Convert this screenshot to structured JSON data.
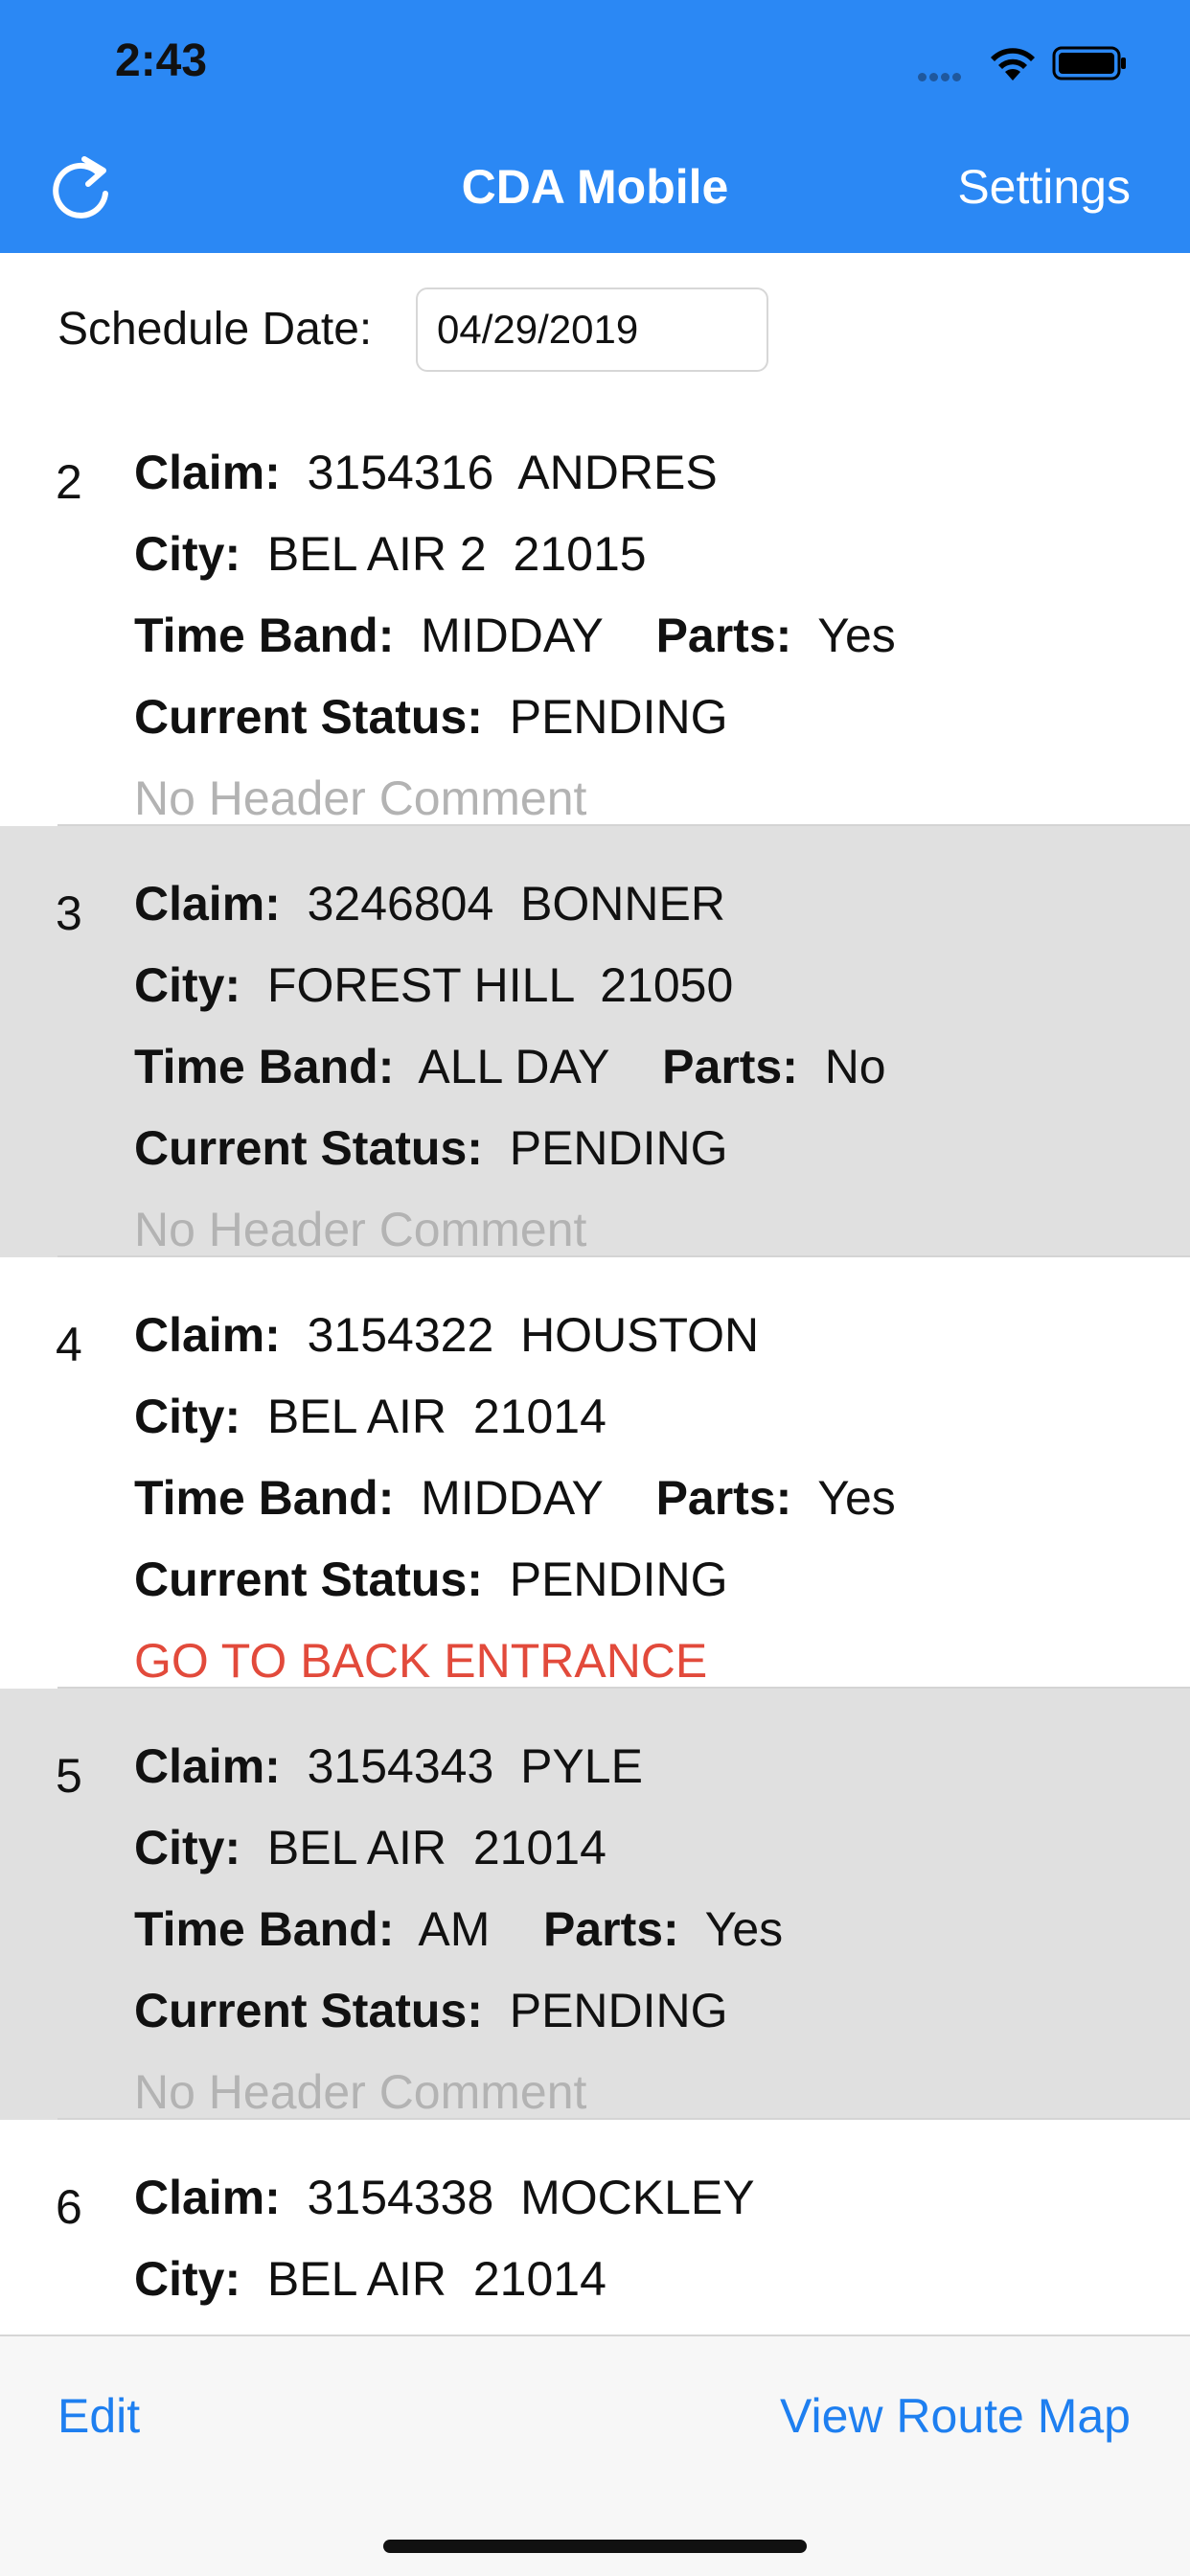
{
  "status_bar": {
    "time": "2:43"
  },
  "nav": {
    "title": "CDA Mobile",
    "settings_label": "Settings",
    "refresh_icon": "refresh-icon"
  },
  "schedule": {
    "label": "Schedule Date:",
    "date_value": "04/29/2019"
  },
  "labels": {
    "claim": "Claim:",
    "city": "City:",
    "time_band": "Time Band:",
    "parts": "Parts:",
    "current_status": "Current Status:"
  },
  "claims": [
    {
      "index": "2",
      "claim_no": "3154316",
      "name": "ANDRES",
      "city": "BEL AIR 2",
      "zip": "21015",
      "time_band": "MIDDAY",
      "parts": "Yes",
      "status": "PENDING",
      "comment": "No Header Comment",
      "comment_type": "muted"
    },
    {
      "index": "3",
      "claim_no": "3246804",
      "name": "BONNER",
      "city": "FOREST HILL",
      "zip": "21050",
      "time_band": "ALL DAY",
      "parts": "No",
      "status": "PENDING",
      "comment": "No Header Comment",
      "comment_type": "muted"
    },
    {
      "index": "4",
      "claim_no": "3154322",
      "name": "HOUSTON",
      "city": "BEL AIR",
      "zip": "21014",
      "time_band": "MIDDAY",
      "parts": "Yes",
      "status": "PENDING",
      "comment": "GO TO BACK ENTRANCE",
      "comment_type": "alert"
    },
    {
      "index": "5",
      "claim_no": "3154343",
      "name": "PYLE",
      "city": "BEL AIR",
      "zip": "21014",
      "time_band": "AM",
      "parts": "Yes",
      "status": "PENDING",
      "comment": "No Header Comment",
      "comment_type": "muted"
    },
    {
      "index": "6",
      "claim_no": "3154338",
      "name": "MOCKLEY",
      "city": "BEL AIR",
      "zip": "21014"
    }
  ],
  "toolbar": {
    "edit_label": "Edit",
    "route_map_label": "View Route Map"
  },
  "colors": {
    "header_bg": "#2b88f4",
    "row_alt_bg": "#e0e0e0",
    "alert_text": "#e24a3b",
    "muted_text": "#b3b3b3",
    "link_blue": "#1e7ff0"
  }
}
